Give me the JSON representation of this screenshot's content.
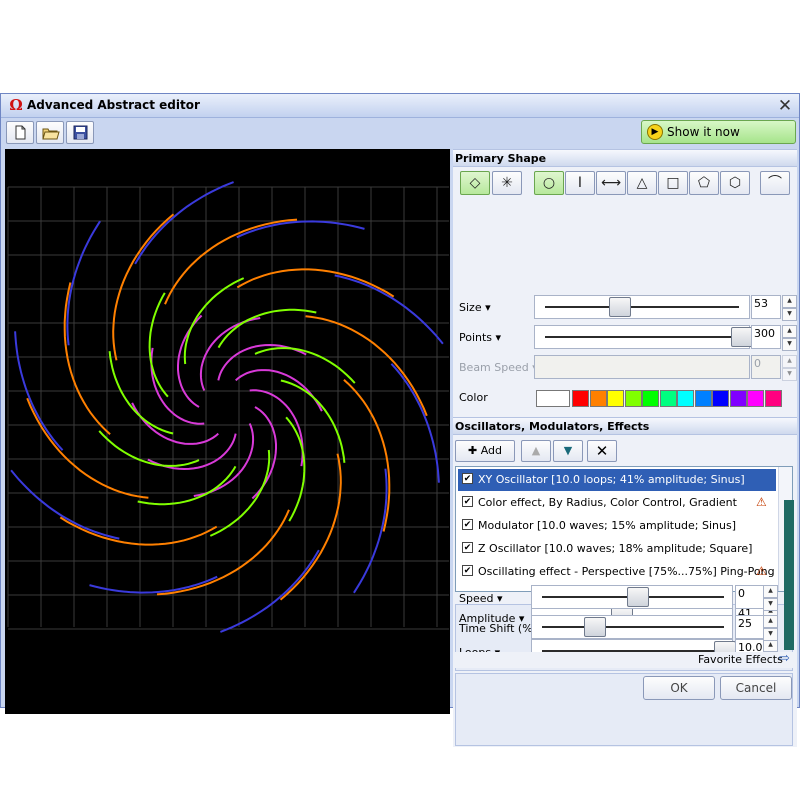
{
  "window": {
    "title": "Advanced Abstract editor",
    "app_icon": "Ω",
    "close_glyph": "✕"
  },
  "toolbar": {
    "icons": [
      "new-file-icon",
      "open-folder-icon",
      "save-icon"
    ],
    "show_now_label": "Show it now"
  },
  "primary_shape": {
    "header": "Primary Shape",
    "mode_buttons": [
      "◇",
      "✳"
    ],
    "shape_buttons": [
      "○",
      "I",
      "⟷",
      "△",
      "□",
      "⬠",
      "⬡"
    ],
    "extra_button": "⌒",
    "size_label": "Size",
    "size_value": "53",
    "size_level": 0.35,
    "points_label": "Points",
    "points_value": "300",
    "points_level": 1.0,
    "beam_speed_label": "Beam Speed",
    "beam_speed_value": "0",
    "color_label": "Color",
    "swatches": [
      "#ffffff",
      "#ff0000",
      "#ff8000",
      "#ffff00",
      "#80ff00",
      "#00ff00",
      "#00ff80",
      "#00ffff",
      "#0080ff",
      "#0000ff",
      "#8000ff",
      "#ff00ff",
      "#ff0080"
    ]
  },
  "oscillators": {
    "header": "Oscillators, Modulators, Effects",
    "add_label": "Add",
    "items": [
      {
        "label": "XY Oscillator [10.0 loops; 41% amplitude; Sinus]",
        "checked": true,
        "selected": true,
        "warn": false
      },
      {
        "label": "Color effect, By Radius, Color Control, Gradient",
        "checked": true,
        "selected": false,
        "warn": true
      },
      {
        "label": "Modulator [10.0 waves; 15% amplitude; Sinus]",
        "checked": true,
        "selected": false,
        "warn": false
      },
      {
        "label": "Z Oscillator [10.0 waves; 18% amplitude; Square]",
        "checked": true,
        "selected": false,
        "warn": false
      },
      {
        "label": "Oscillating effect - Perspective [75%...75%] Ping-Pong",
        "checked": true,
        "selected": false,
        "warn": true
      }
    ]
  },
  "params": {
    "amplitude_label": "Amplitude",
    "amplitude_value": "41",
    "amplitude_level": 0.41,
    "loops_label": "Loops",
    "loops_value": "10.0",
    "loops_level": 1.0,
    "speed_label": "Speed",
    "speed_value": "0",
    "speed_level": 0.5,
    "timeshift_label": "Time Shift (%)",
    "timeshift_value": "25",
    "timeshift_level": 0.25
  },
  "footer": {
    "favorite_label": "Favorite Effects",
    "ok_label": "OK",
    "cancel_label": "Cancel"
  },
  "preview_colors": [
    "#3a3adc",
    "#7a3ad8",
    "#d83ad8",
    "#ff8000",
    "#80ff00",
    "#00ff40"
  ]
}
